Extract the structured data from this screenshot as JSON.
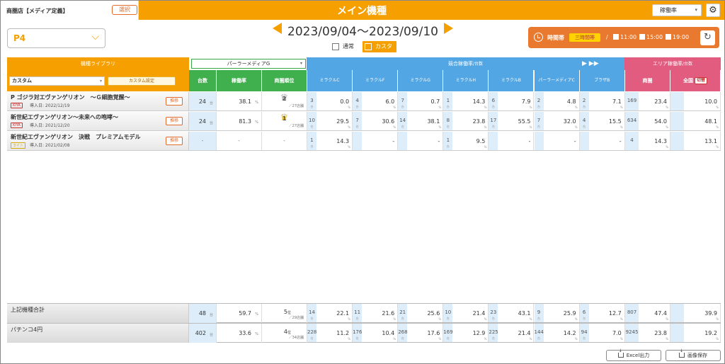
{
  "header": {
    "store_name": "商圏店【メディア定義】",
    "select_label": "選択",
    "title": "メイン機種",
    "metric": "稼働率",
    "metric_chevron": "▾",
    "gear_icon": "⚙"
  },
  "model_select": {
    "value": "P4",
    "chevron": "⌵"
  },
  "date_range": "2023/09/04～2023/09/10",
  "view": {
    "normal": "通常",
    "custom": "カスタム"
  },
  "time_box": {
    "label": "時間帯",
    "range_btn": "三時間帯",
    "slash": "/",
    "checks": [
      "11:00",
      "15:00",
      "19:00"
    ],
    "refresh_icon": "↻"
  },
  "sections": {
    "library": "機種ライブラリ",
    "pm_select": "パーラーメディアG",
    "pm_chevron": "▾",
    "compare": "競合稼働率",
    "compare_sub": "/台数",
    "area": "エリア稼働率",
    "area_sub": "/台数",
    "nav": "▶ ▶▶"
  },
  "library_controls": {
    "custom_select": "カスタム",
    "custom_chevron": "▾",
    "custom_set": "カスタム設定"
  },
  "columns": {
    "own": [
      "台数",
      "稼働率",
      "商圏順位"
    ],
    "compare": [
      "ミラクルC",
      "ミラクルF",
      "ミラクルG",
      "ミラクルH",
      "ミラクルB",
      "パーラーメディアC",
      "ブラザB"
    ],
    "area": [
      "商圏",
      "全国"
    ],
    "switch_btn": "切替"
  },
  "units": {
    "machines": "台",
    "percent": "%",
    "rank": "位",
    "rank_of_prefix": "／",
    "rank_of_suffix": "店舗",
    "small_unit": "台"
  },
  "rows": [
    {
      "name": "P ゴジラ対エヴァンゲリオン　～Ｇ細胞覚醒～",
      "tag": "KIYA",
      "intro": "導入日: 2022/12/19",
      "trans": "推移",
      "count": "24",
      "rate": "38.1",
      "rank": "2",
      "rank_of": "27",
      "pairs": [
        [
          "3",
          "0.0"
        ],
        [
          "4",
          "6.0"
        ],
        [
          "7",
          "0.7"
        ],
        [
          "1",
          "14.3"
        ],
        [
          "6",
          "7.9"
        ],
        [
          "2",
          "4.8"
        ],
        [
          "2",
          "7.1"
        ]
      ],
      "area": [
        [
          "169",
          "23.4"
        ],
        [
          "",
          "10.0"
        ]
      ]
    },
    {
      "name": "新世紀エヴァンゲリオン～未来への咆哮～",
      "tag": "KIYA",
      "intro": "導入日: 2021/12/20",
      "trans": "推移",
      "count": "24",
      "rate": "81.3",
      "rank": "1",
      "rank_of": "27",
      "pairs": [
        [
          "10",
          "29.5"
        ],
        [
          "7",
          "30.6"
        ],
        [
          "14",
          "38.1"
        ],
        [
          "8",
          "23.8"
        ],
        [
          "17",
          "55.5"
        ],
        [
          "7",
          "32.0"
        ],
        [
          "4",
          "15.5"
        ]
      ],
      "area": [
        [
          "634",
          "54.0"
        ],
        [
          "",
          "48.1"
        ]
      ]
    },
    {
      "name": "新世紀エヴァンゲリオン　決戦　プレミアムモデル",
      "tag": "ライト",
      "intro": "導入日: 2021/02/08",
      "trans": "推移",
      "count": "-",
      "rate": "-",
      "rank": "-",
      "rank_of": "",
      "pairs": [
        [
          "1",
          "14.3"
        ],
        [
          "",
          "-"
        ],
        [
          "",
          "-"
        ],
        [
          "1",
          "9.5"
        ],
        [
          "",
          "-"
        ],
        [
          "",
          "-"
        ],
        [
          "",
          "-"
        ]
      ],
      "area": [
        [
          "4",
          "14.3"
        ],
        [
          "",
          "13.1"
        ]
      ]
    }
  ],
  "footer_rows": [
    {
      "name": "上記機種合計",
      "count": "48",
      "rate": "59.7",
      "rank": "5",
      "rank_of": "29",
      "pairs": [
        [
          "14",
          "22.1"
        ],
        [
          "11",
          "21.6"
        ],
        [
          "21",
          "25.6"
        ],
        [
          "10",
          "21.4"
        ],
        [
          "23",
          "43.1"
        ],
        [
          "9",
          "25.9"
        ],
        [
          "6",
          "12.7"
        ]
      ],
      "area": [
        [
          "807",
          "47.4"
        ],
        [
          "",
          "39.9"
        ]
      ]
    },
    {
      "name": "パチンコ4円",
      "count": "402",
      "rate": "33.6",
      "rank": "4",
      "rank_of": "34",
      "pairs": [
        [
          "228",
          "11.2"
        ],
        [
          "176",
          "10.4"
        ],
        [
          "268",
          "17.6"
        ],
        [
          "169",
          "12.9"
        ],
        [
          "225",
          "21.4"
        ],
        [
          "144",
          "14.2"
        ],
        [
          "94",
          "7.0"
        ]
      ],
      "area": [
        [
          "9245",
          "23.8"
        ],
        [
          "",
          "19.2"
        ]
      ]
    }
  ],
  "buttons": {
    "excel": "Excel出力",
    "image": "画像保存"
  },
  "colors": {
    "accent": "#f5a000",
    "green": "#40b04e",
    "blue": "#52a6e3",
    "pink": "#e15c7f"
  }
}
